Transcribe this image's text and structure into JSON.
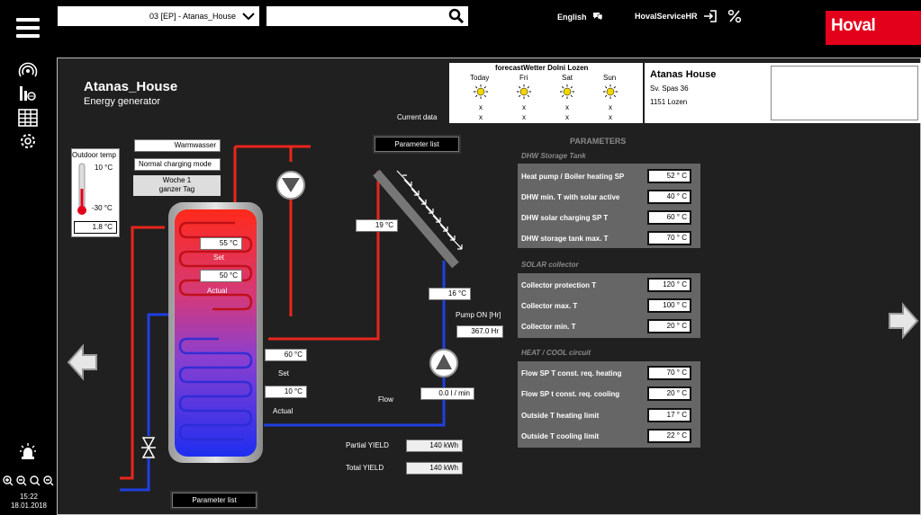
{
  "header": {
    "plant_select": "03 [EP] - Atanas_House",
    "language": "English",
    "user": "HovalServiceHR",
    "logo": "Hoval"
  },
  "page": {
    "title": "Atanas_House",
    "subtitle": "Energy generator"
  },
  "forecast": {
    "title": "forecastWetter Dolni Lozen",
    "days": [
      "Today",
      "Fri",
      "Sat",
      "Sun"
    ],
    "row1": [
      "x",
      "x",
      "x",
      "x"
    ],
    "row2": [
      "x",
      "x",
      "x",
      "x"
    ],
    "current_label": "Current data"
  },
  "address": {
    "name": "Atanas House",
    "street": "Sv. Spas 36",
    "city": "1151 Lozen"
  },
  "outdoor": {
    "label": "Outdoor temp",
    "max": "10 °C",
    "min": "-30 °C",
    "value": "1.8 °C"
  },
  "mode": {
    "type": "Warmwasser",
    "charging": "Normal charging mode",
    "week": "Woche 1",
    "day": "ganzer Tag"
  },
  "diagram": {
    "param_list_top": "Parameter list",
    "param_list_bottom": "Parameter list",
    "tank_top_set": "55 °C",
    "tank_top_set_label": "Set",
    "tank_top_actual": "50 °C",
    "tank_top_actual_label": "Actual",
    "tank_bottom_set": "60 °C",
    "tank_bottom_set_label": "Set",
    "tank_bottom_actual": "10 °C",
    "tank_bottom_actual_label": "Actual",
    "collector_temp": "19 °C",
    "return_temp": "16 °C",
    "pump_on_label": "Pump ON [Hr]",
    "pump_on_value": "367.0 Hr",
    "flow_label": "Flow",
    "flow_value": "0.0 l / min",
    "partial_yield_label": "Partial YIELD",
    "partial_yield_value": "140 kWh",
    "total_yield_label": "Total YIELD",
    "total_yield_value": "140 kWh"
  },
  "params": {
    "title": "PARAMETERS",
    "sections": [
      {
        "title": "DHW Storage Tank",
        "rows": [
          {
            "label": "Heat pump / Boiler heating SP",
            "value": "52 ° C"
          },
          {
            "label": "DHW min. T with solar active",
            "value": "40 ° C"
          },
          {
            "label": "DHW solar charging SP T",
            "value": "60 ° C"
          },
          {
            "label": "DHW storage tank max. T",
            "value": "70 ° C"
          }
        ]
      },
      {
        "title": "SOLAR collector",
        "rows": [
          {
            "label": "Collector protection T",
            "value": "120 ° C"
          },
          {
            "label": "Collector max. T",
            "value": "100 ° C"
          },
          {
            "label": "Collector min. T",
            "value": "20 ° C"
          }
        ]
      },
      {
        "title": "HEAT / COOL circuit",
        "rows": [
          {
            "label": "Flow SP T const. req. heating",
            "value": "70 ° C"
          },
          {
            "label": "Flow SP t const. req. cooling",
            "value": "20 ° C"
          },
          {
            "label": "Outside T heating limit",
            "value": "17 ° C"
          },
          {
            "label": "Outside T cooling limit",
            "value": "22 ° C"
          }
        ]
      }
    ]
  },
  "footer": {
    "time": "15:22",
    "date": "18.01.2018"
  },
  "colors": {
    "brand": "#e3001b",
    "hot_pipe": "#e8261c",
    "cold_pipe": "#1f3fe0"
  }
}
